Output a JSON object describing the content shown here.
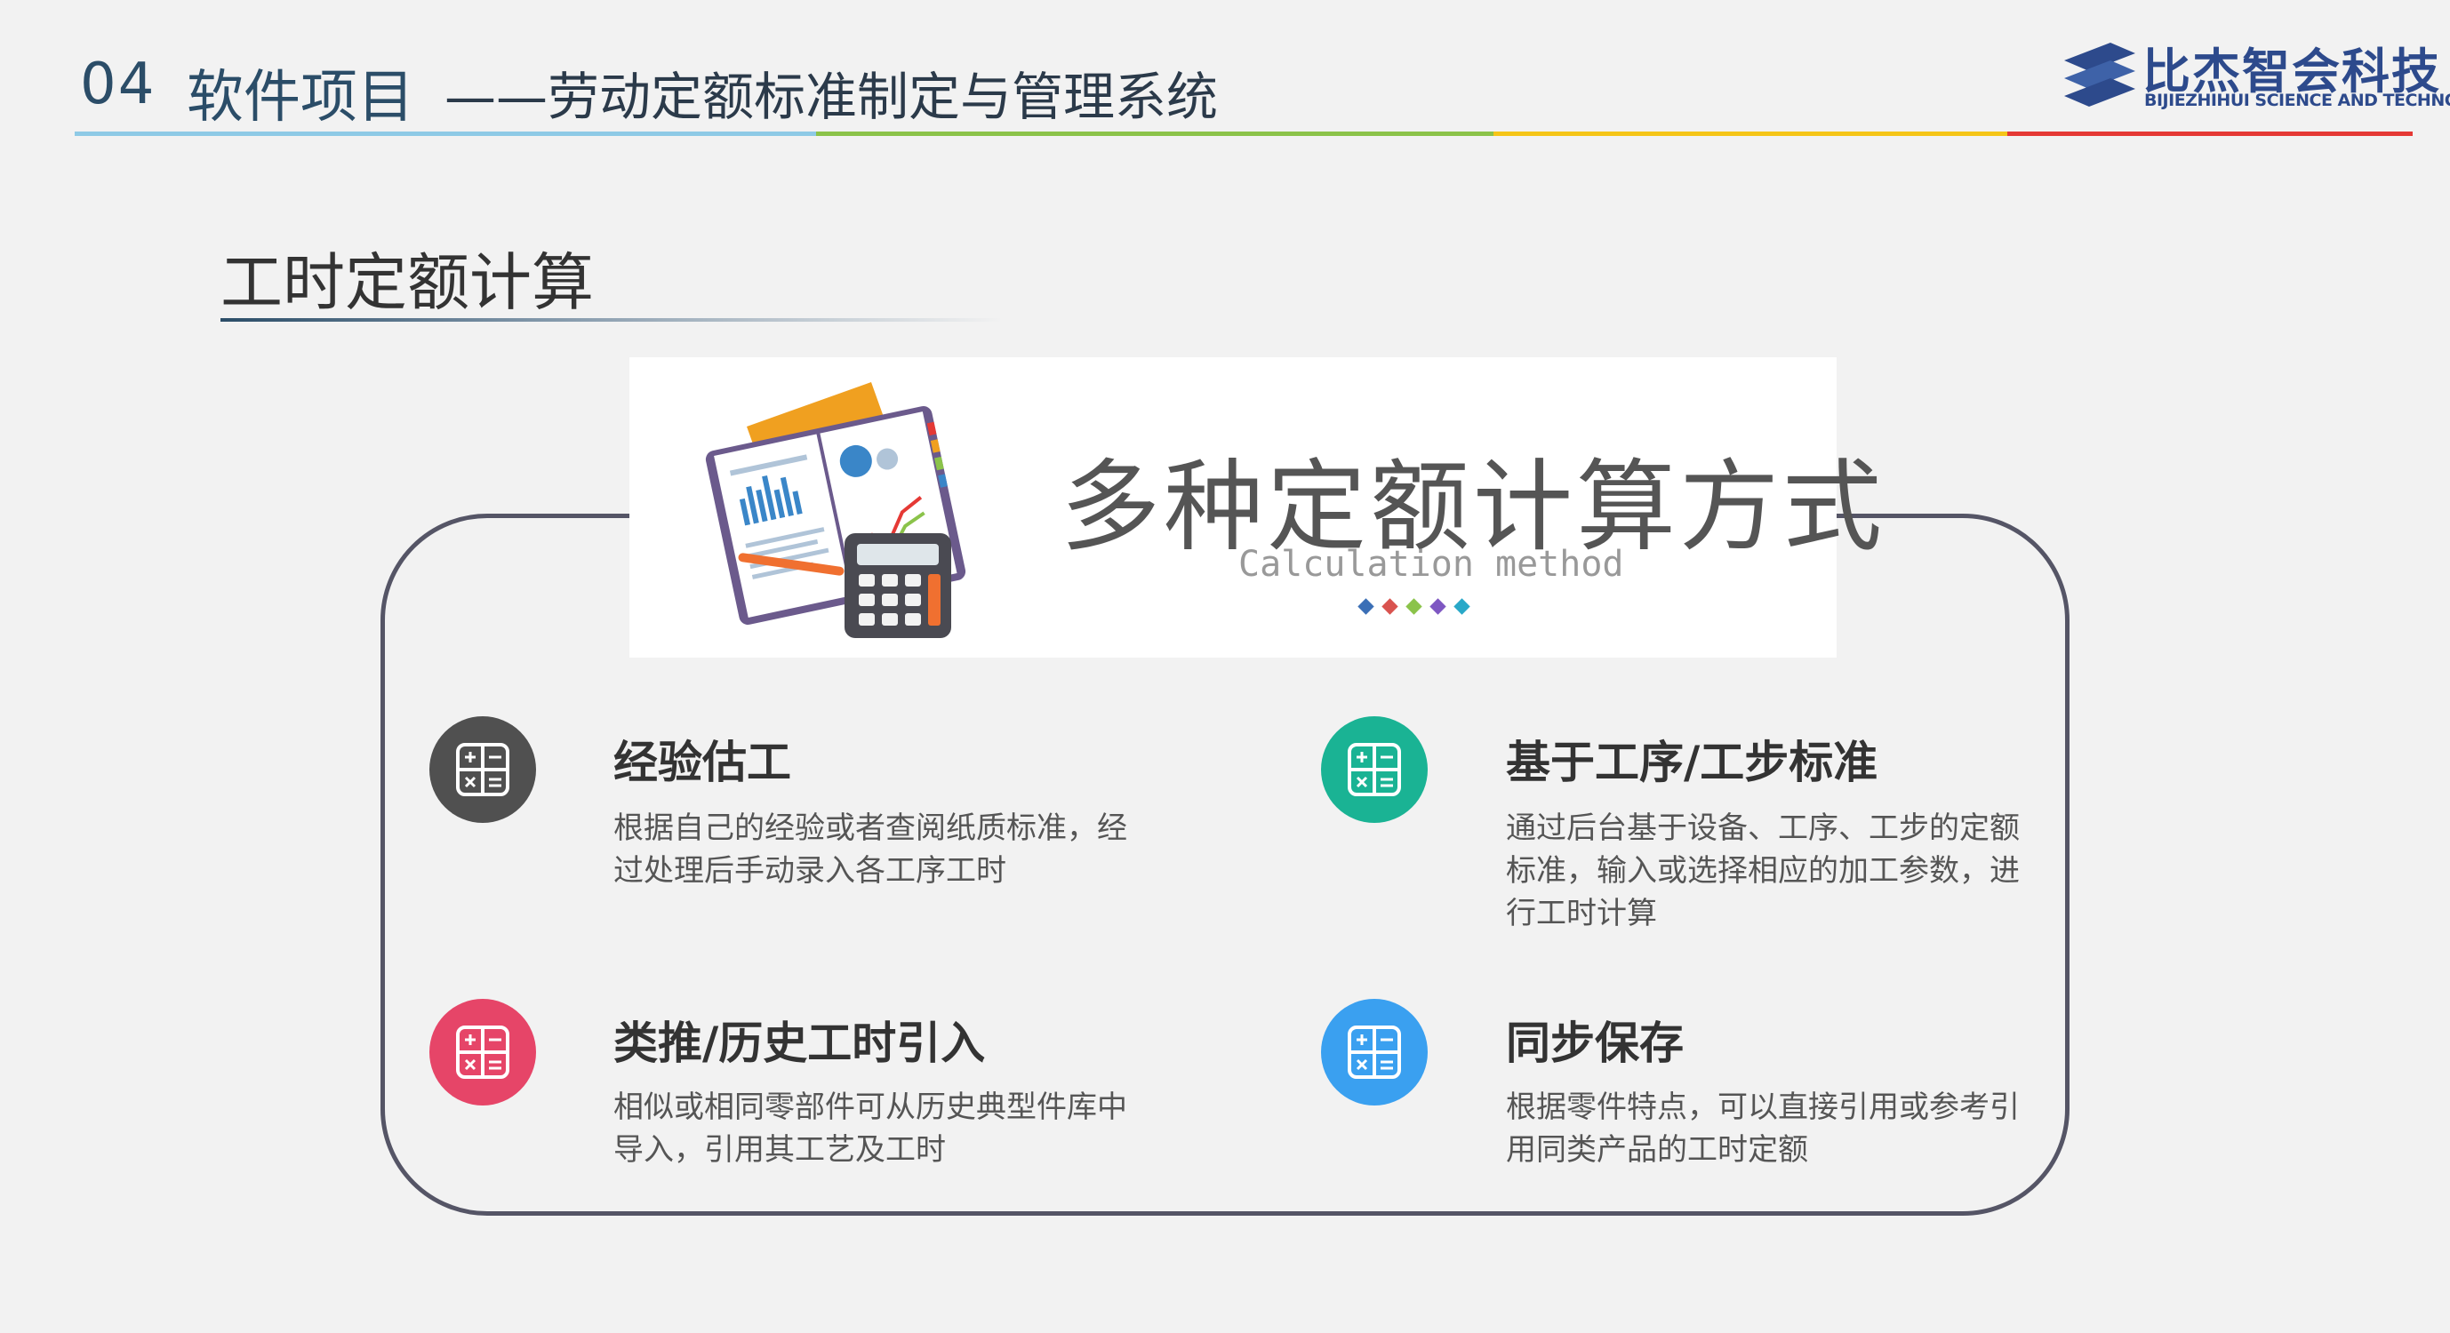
{
  "header": {
    "number": "04",
    "title": "软件项目",
    "subtitle": "——劳动定额标准制定与管理系统",
    "line_colors": [
      "#8ecae6",
      "#8bc34a",
      "#f5c518",
      "#e53935"
    ]
  },
  "logo": {
    "name_cn": "比杰智会科技",
    "name_en": "BIJIEZHIHUI SCIENCE AND TECHNOLOGY",
    "color": "#2d4a8c"
  },
  "section": {
    "title": "工时定额计算"
  },
  "banner": {
    "title": "多种定额计算方式",
    "subtitle_en": "Calculation method",
    "dot_colors": [
      "#3b6fb6",
      "#d9534f",
      "#8bc34a",
      "#7e57c2",
      "#29a8c8"
    ]
  },
  "features": [
    {
      "title": "经验估工",
      "desc": "根据自己的经验或者查阅纸质标准，经过处理后手动录入各工序工时",
      "color": "#505050",
      "icon": "calculator-icon"
    },
    {
      "title": "基于工序/工步标准",
      "desc": "通过后台基于设备、工序、工步的定额标准，输入或选择相应的加工参数，进行工时计算",
      "color": "#1ab394",
      "icon": "calculator-icon"
    },
    {
      "title": "类推/历史工时引入",
      "desc": "相似或相同零部件可从历史典型件库中导入，引用其工艺及工时",
      "color": "#e64568",
      "icon": "calculator-icon"
    },
    {
      "title": "同步保存",
      "desc": "根据零件特点，可以直接引用或参考引用同类产品的工时定额",
      "color": "#3aa0f0",
      "icon": "calculator-icon"
    }
  ]
}
